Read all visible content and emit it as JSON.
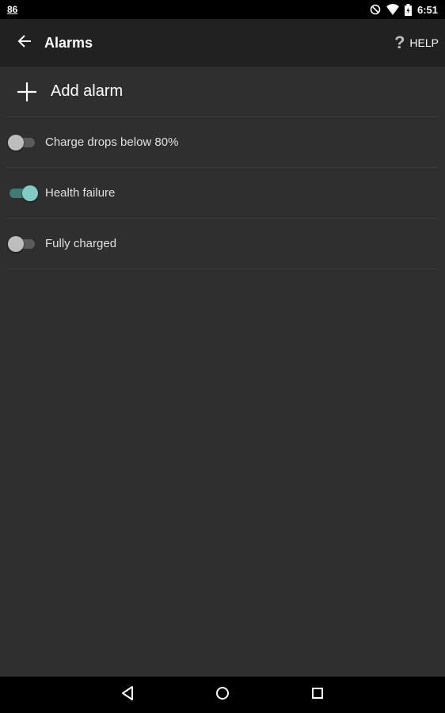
{
  "status_bar": {
    "left_text": "86",
    "time": "6:51",
    "icons": [
      "do-not-disturb-icon",
      "wifi-icon",
      "battery-charging-icon"
    ]
  },
  "app_bar": {
    "back_icon": "arrow-back-icon",
    "title": "Alarms",
    "help_icon": "question-mark-icon",
    "help_label": "HELP"
  },
  "add_alarm": {
    "icon": "plus-icon",
    "label": "Add alarm"
  },
  "alarms": [
    {
      "label": "Charge drops below 80%",
      "enabled": false
    },
    {
      "label": "Health failure",
      "enabled": true
    },
    {
      "label": "Fully charged",
      "enabled": false
    }
  ],
  "colors": {
    "background": "#2f2f2f",
    "app_bar": "#212121",
    "accent": "#80cbc4",
    "divider": "#3e3e3e"
  },
  "nav_bar": {
    "icons": [
      "back-triangle-icon",
      "home-circle-icon",
      "recents-square-icon"
    ]
  }
}
